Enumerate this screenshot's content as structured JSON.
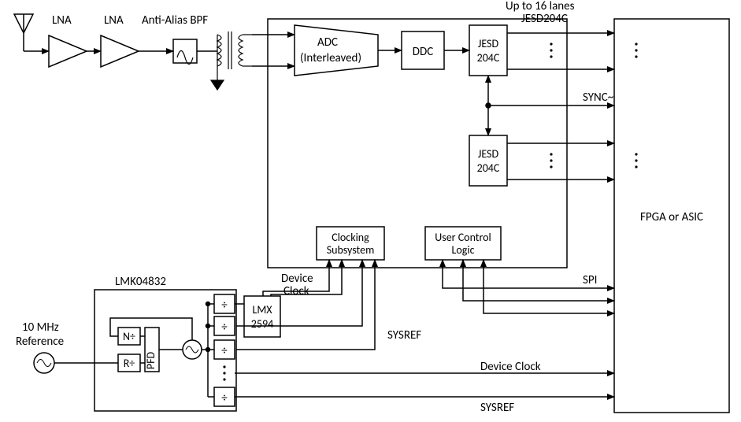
{
  "labels": {
    "lna1": "LNA",
    "lna2": "LNA",
    "bpf": "Anti-Alias BPF",
    "adc1": "ADC",
    "adc2": "(Interleaved)",
    "ddc": "DDC",
    "jesd_a1": "JESD",
    "jesd_a2": "204C",
    "jesd_b1": "JESD",
    "jesd_b2": "204C",
    "lanes1": "Up to 16 lanes",
    "lanes2": "JESD204C",
    "sync": "SYNC~",
    "fpga": "FPGA or ASIC",
    "clk1": "Clocking",
    "clk2": "Subsystem",
    "ucl1": "User Control",
    "ucl2": "Logic",
    "spi": "SPI",
    "devclk": "Device",
    "devclk2": "Clock",
    "lmx1": "LMX",
    "lmx2": "2594",
    "lmk": "LMK04832",
    "ref1": "10 MHz",
    "ref2": "Reference",
    "ndiv": "N÷",
    "pfd": "PFD",
    "rdiv": "R÷",
    "div": "÷",
    "sysref1": "SYSREF",
    "sysref2": "SYSREF",
    "devclk_line": "Device Clock"
  }
}
